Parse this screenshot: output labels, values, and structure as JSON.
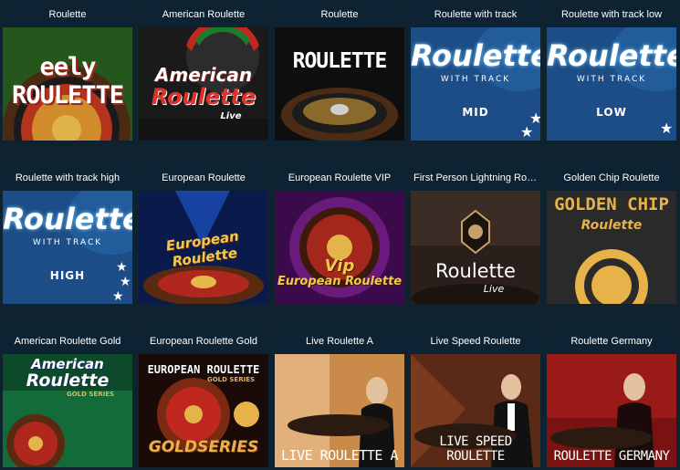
{
  "games": [
    {
      "title": "Roulette",
      "logo": "eely ROULETTE"
    },
    {
      "title": "American Roulette",
      "logo_line1": "American",
      "logo_line2": "Roulette",
      "logo_sub": "Live"
    },
    {
      "title": "Roulette",
      "logo": "ROULETTE"
    },
    {
      "title": "Roulette with track",
      "logo_line1": "Roulette",
      "logo_line2": "WITH TRACK",
      "badge": "MID"
    },
    {
      "title": "Roulette with track low",
      "logo_line1": "Roulette",
      "logo_line2": "WITH TRACK",
      "badge": "LOW"
    },
    {
      "title": "Roulette with track high",
      "logo_line1": "Roulette",
      "logo_line2": "WITH TRACK",
      "badge": "HIGH"
    },
    {
      "title": "European Roulette",
      "logo": "European Roulette"
    },
    {
      "title": "European Roulette VIP",
      "logo_line1": "Vip",
      "logo_line2": "European Roulette"
    },
    {
      "title": "First Person Lightning Rou...",
      "logo_line1": "Roulette",
      "logo_sub": "Live"
    },
    {
      "title": "Golden Chip Roulette",
      "logo_line1": "GOLDEN CHIP",
      "logo_line2": "Roulette"
    },
    {
      "title": "American Roulette Gold",
      "logo_line1": "American",
      "logo_line2": "Roulette",
      "logo_sub": "GOLD SERIES"
    },
    {
      "title": "European Roulette Gold",
      "logo_line1": "EUROPEAN ROULETTE",
      "logo_sub": "GOLD SERIES",
      "logo_line2": "GOLDSERIES"
    },
    {
      "title": "Live Roulette A",
      "caption": "LIVE ROULETTE A"
    },
    {
      "title": "Live Speed Roulette",
      "caption": "LIVE SPEED ROULETTE"
    },
    {
      "title": "Roulette Germany",
      "caption": "ROULETTE GERMANY"
    }
  ],
  "colors": {
    "page_bg": "#0f2230",
    "tile_title_bg": "#0d2333",
    "track_blue": "#1c4d86",
    "gold": "#e7b24a"
  }
}
